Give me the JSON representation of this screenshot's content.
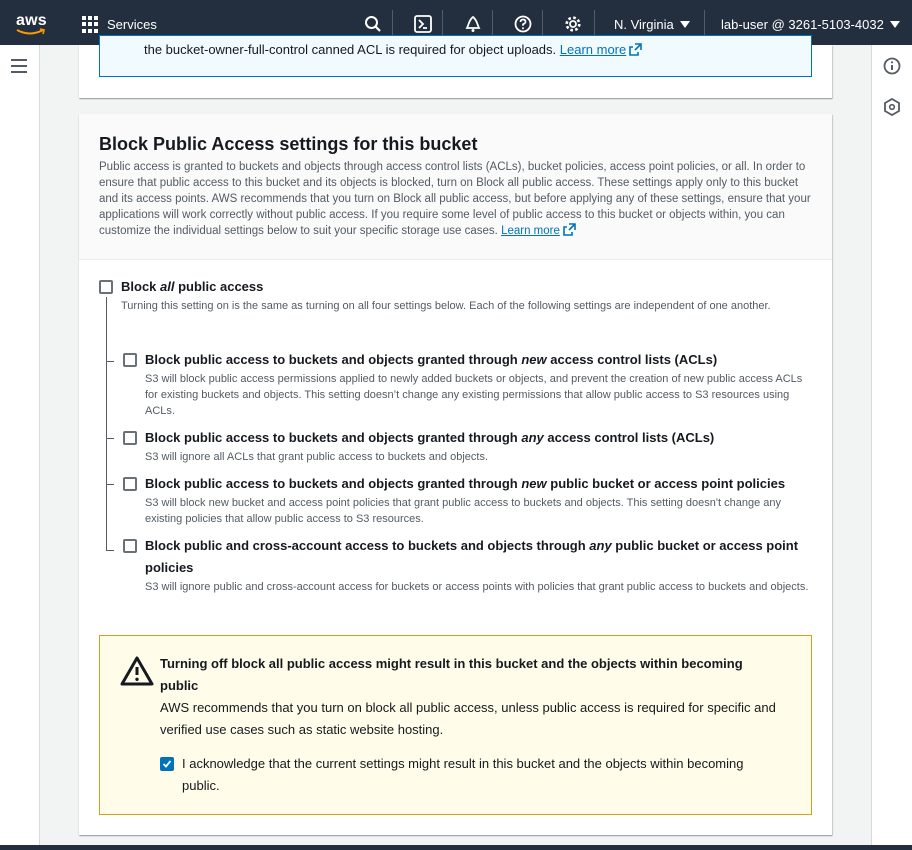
{
  "nav": {
    "logo_text": "aws",
    "services_label": "Services",
    "region_label": "N. Virginia",
    "user_label": "lab-user @ 3261-5103-4032"
  },
  "top_panel": {
    "notice_text": "the bucket-owner-full-control canned ACL is required for object uploads.",
    "learn_more": "Learn more"
  },
  "section": {
    "title": "Block Public Access settings for this bucket",
    "description": "Public access is granted to buckets and objects through access control lists (ACLs), bucket policies, access point policies, or all. In order to ensure that public access to this bucket and its objects is blocked, turn on Block all public access. These settings apply only to this bucket and its access points. AWS recommends that you turn on Block all public access, but before applying any of these settings, ensure that your applications will work correctly without public access. If you require some level of public access to this bucket or objects within, you can customize the individual settings below to suit your specific storage use cases.",
    "learn_more": "Learn more"
  },
  "block_all": {
    "title_pre": "Block ",
    "title_em": "all",
    "title_post": " public access",
    "checked": false,
    "description": "Turning this setting on is the same as turning on all four settings below. Each of the following settings are independent of one another."
  },
  "options": [
    {
      "title_pre": "Block public access to buckets and objects granted through ",
      "title_em": "new",
      "title_post": " access control lists (ACLs)",
      "checked": false,
      "description": "S3 will block public access permissions applied to newly added buckets or objects, and prevent the creation of new public access ACLs for existing buckets and objects. This setting doesn’t change any existing permissions that allow public access to S3 resources using ACLs."
    },
    {
      "title_pre": "Block public access to buckets and objects granted through ",
      "title_em": "any",
      "title_post": " access control lists (ACLs)",
      "checked": false,
      "description": "S3 will ignore all ACLs that grant public access to buckets and objects."
    },
    {
      "title_pre": "Block public access to buckets and objects granted through ",
      "title_em": "new",
      "title_post": " public bucket or access point policies",
      "checked": false,
      "description": "S3 will block new bucket and access point policies that grant public access to buckets and objects. This setting doesn't change any existing policies that allow public access to S3 resources."
    },
    {
      "title_pre": "Block public and cross-account access to buckets and objects through ",
      "title_em": "any",
      "title_post": " public bucket or access point policies",
      "checked": false,
      "description": "S3 will ignore public and cross-account access for buckets or access points with policies that grant public access to buckets and objects."
    }
  ],
  "warning": {
    "title": "Turning off block all public access might result in this bucket and the objects within becoming public",
    "body": "AWS recommends that you turn on block all public access, unless public access is required for specific and verified use cases such as static website hosting.",
    "ack_label": "I acknowledge that the current settings might result in this bucket and the objects within becoming public.",
    "ack_checked": true
  },
  "colors": {
    "nav_bg": "#232f3e",
    "link": "#0073bb",
    "warning_border": "#d5a217",
    "warning_bg": "#fffce9"
  }
}
